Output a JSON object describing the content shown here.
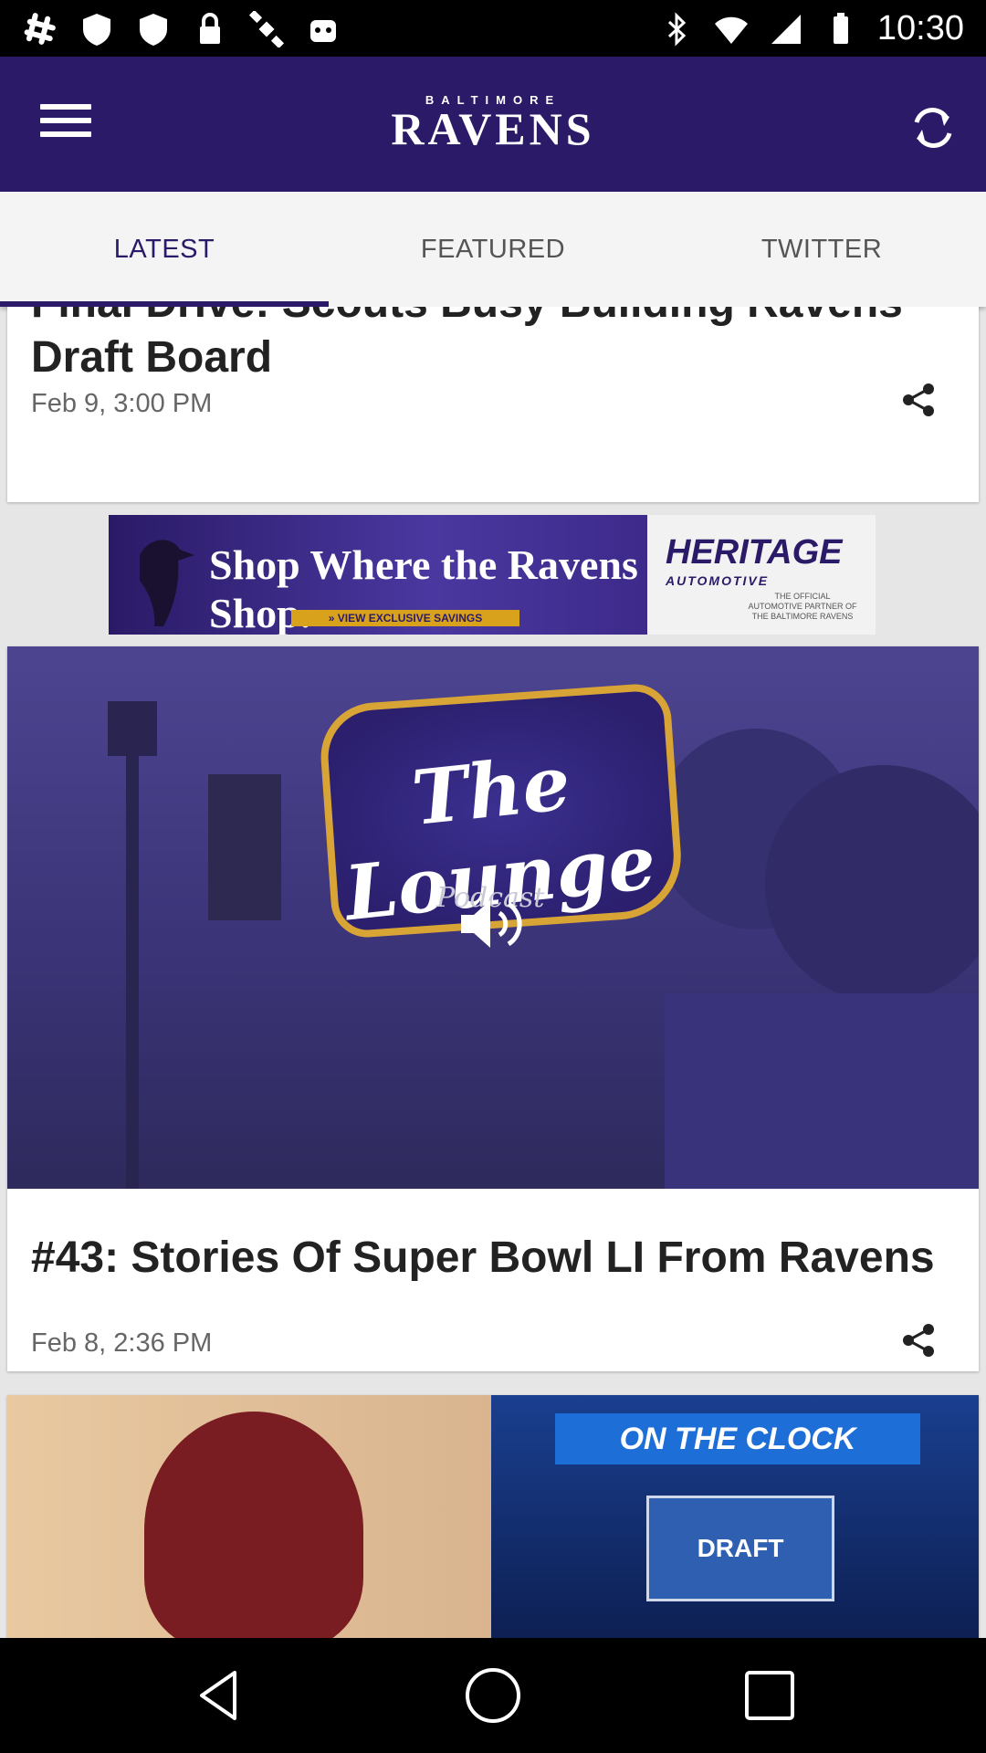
{
  "status_bar": {
    "time": "10:30"
  },
  "app_bar": {
    "logo_small": "BALTIMORE",
    "logo_big": "RAVENS"
  },
  "tabs": [
    {
      "label": "LATEST",
      "active": true
    },
    {
      "label": "FEATURED",
      "active": false
    },
    {
      "label": "TWITTER",
      "active": false
    }
  ],
  "articles": [
    {
      "title": "Final Drive: Scouts Busy Building Ravens Draft Board",
      "date": "Feb 9, 3:00 PM"
    },
    {
      "title": "#43: Stories Of Super Bowl LI From Ravens",
      "date": "Feb 8, 2:36 PM"
    }
  ],
  "ad": {
    "headline": "Shop Where the Ravens Shop.",
    "cta": "»   VIEW EXCLUSIVE SAVINGS",
    "brand": "HERITAGE",
    "brand_sub": "AUTOMOTIVE",
    "brand_note": "THE OFFICIAL AUTOMOTIVE PARTNER OF THE BALTIMORE RAVENS"
  },
  "podcast_art": {
    "title": "The Lounge",
    "subtitle": "Podcast"
  },
  "draft_art": {
    "banner": "ON THE CLOCK",
    "board": "DRAFT"
  }
}
